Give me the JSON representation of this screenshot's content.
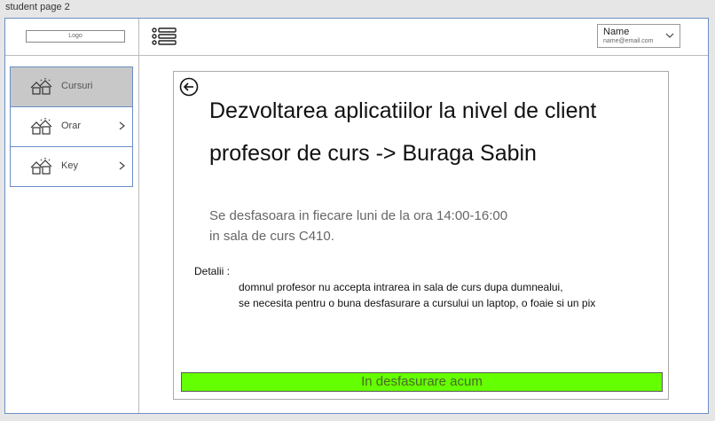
{
  "page": {
    "title": "student page 2"
  },
  "header": {
    "logo_text": "Logo",
    "user": {
      "name": "Name",
      "email": "name@email.com"
    }
  },
  "sidebar": {
    "items": [
      {
        "label": "Cursuri",
        "active": true
      },
      {
        "label": "Orar",
        "active": false
      },
      {
        "label": "Key",
        "active": false
      }
    ]
  },
  "course": {
    "title": "Dezvoltarea aplicatiilor la nivel de client",
    "professor": "profesor de curs -> Buraga Sabin",
    "schedule": [
      "Se desfasoara in fiecare luni de la ora 14:00-16:00",
      "in sala de curs C410."
    ],
    "details_label": "Detalii :",
    "details": [
      "domnul profesor nu accepta intrarea in sala de curs dupa dumnealui,",
      "se necesita pentru o buna desfasurare a cursului un laptop, o foaie si un pix"
    ],
    "status": "In desfasurare acum"
  },
  "colors": {
    "status_green": "#64ff00",
    "accent_border": "#6a8fc4",
    "active_item": "#c8c8c8"
  },
  "icons": {
    "menu": "list-menu-icon",
    "nav": "house-icon",
    "back": "back-arrow-icon",
    "chevron": "chevron-right-icon",
    "dropdown": "chevron-down-icon"
  }
}
